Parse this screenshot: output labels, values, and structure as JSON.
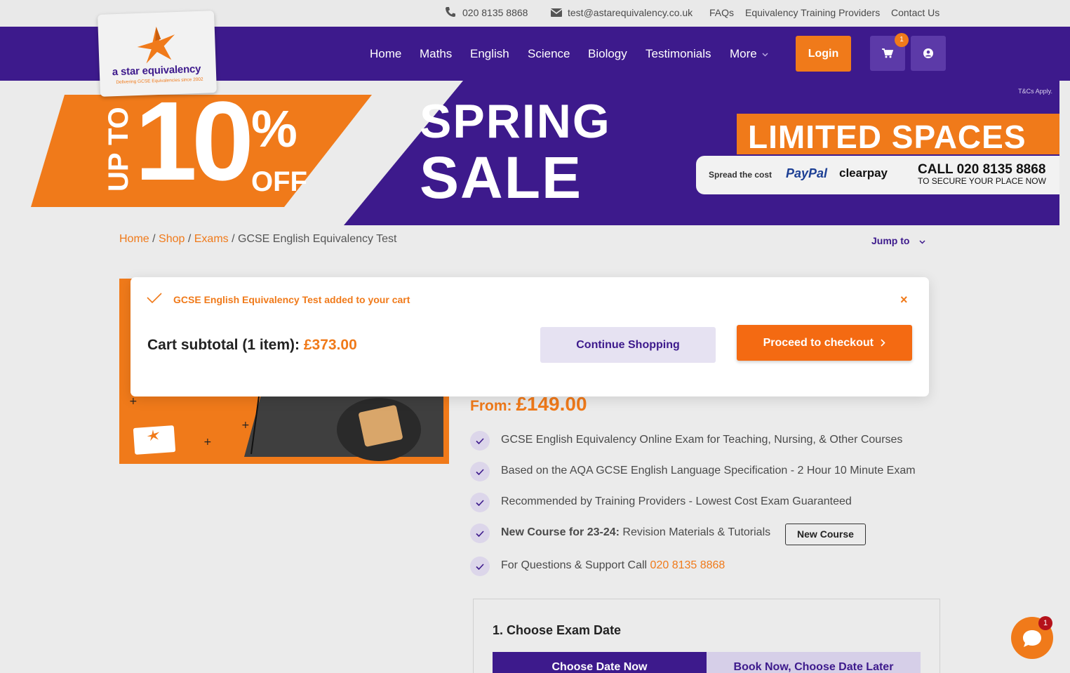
{
  "topbar": {
    "phone": "020 8135 8868",
    "email": "test@astarequivalency.co.uk",
    "links": [
      "FAQs",
      "Equivalency Training Providers",
      "Contact Us"
    ]
  },
  "logo": {
    "wordmark": "a star equivalency",
    "tagline": "Delivering GCSE Equivalencies since 2002"
  },
  "nav": {
    "items": [
      "Home",
      "Maths",
      "English",
      "Science",
      "Biology",
      "Testimonials",
      "More"
    ],
    "login_label": "Login",
    "cart_count": "1"
  },
  "banner": {
    "upto": "UP TO",
    "ten": "10",
    "percent": "%",
    "off": "OFF",
    "spring": "SPRING",
    "sale": "SALE",
    "limited": "LIMITED SPACES",
    "spread": "Spread the cost",
    "paypal": "PayPal",
    "clearpay": "clearpay",
    "call": "CALL 020 8135 8868",
    "secure": "TO SECURE YOUR PLACE NOW",
    "tcs": "T&Cs Apply."
  },
  "breadcrumb": {
    "home": "Home",
    "shop": "Shop",
    "exams": "Exams",
    "current": "GCSE English Equivalency Test",
    "sep": " / "
  },
  "jump_to": "Jump to",
  "product": {
    "price_from": "From:",
    "price_value": "£149.00",
    "features": [
      "GCSE English Equivalency Online Exam for Teaching, Nursing, & Other Courses",
      "Based on the AQA GCSE English Language Specification - 2 Hour 10 Minute Exam",
      "Recommended by Training Providers - Lowest Cost Exam Guaranteed"
    ],
    "feature_new_bold": "New Course for 23-24:",
    "feature_new_rest": " Revision Materials & Tutorials",
    "new_course_badge": "New Course",
    "feature_support": "For Questions & Support Call ",
    "support_phone": "020 8135 8868"
  },
  "exam": {
    "title": "1. Choose Exam Date",
    "date_now": "Choose Date Now",
    "date_later": "Book Now, Choose Date Later"
  },
  "popup": {
    "added_message": "GCSE English Equivalency Test added to your cart",
    "close": "×",
    "subtotal_label": "Cart subtotal (1 item):",
    "subtotal_amount": "£373.00",
    "continue": "Continue Shopping",
    "checkout": "Proceed to checkout"
  },
  "chat": {
    "badge": "1"
  },
  "colors": {
    "brand_purple": "#3d1a8c",
    "brand_orange": "#f07a1a",
    "background": "#ebebeb"
  }
}
